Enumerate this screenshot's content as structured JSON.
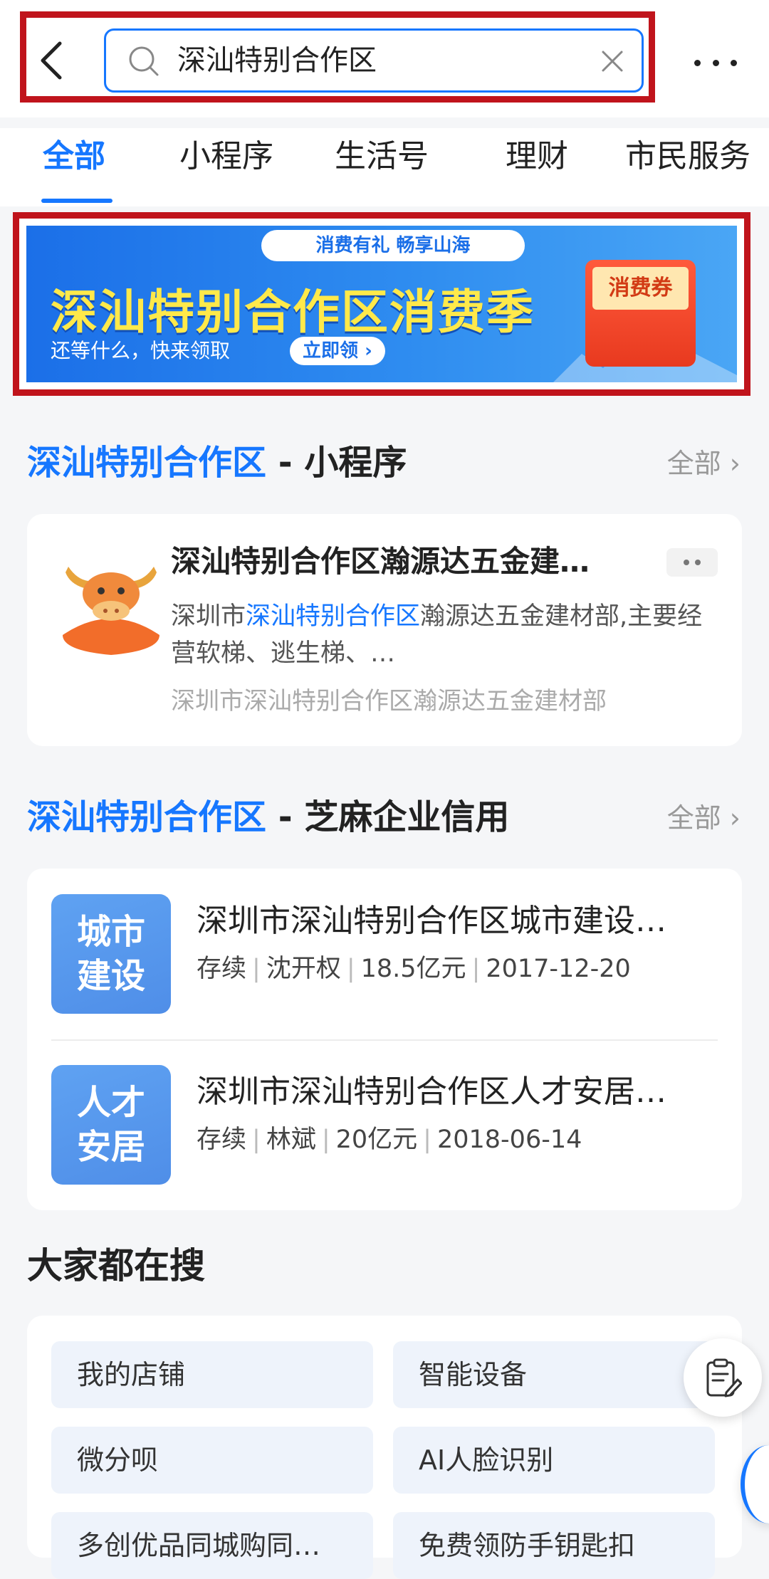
{
  "search": {
    "query": "深汕特别合作区"
  },
  "tabs": [
    {
      "label": "全部"
    },
    {
      "label": "小程序"
    },
    {
      "label": "生活号"
    },
    {
      "label": "理财"
    },
    {
      "label": "市民服务"
    }
  ],
  "banner": {
    "pill": "消费有礼 畅享山海",
    "title": "深汕特别合作区消费季",
    "subtitle": "还等什么，快来领取",
    "cta": "立即领",
    "coupon": "消费券"
  },
  "section_miniprogram": {
    "keyword": "深汕特别合作区",
    "suffix": " - 小程序",
    "more": "全部",
    "item": {
      "title": "深汕特别合作区瀚源达五金建…",
      "desc_prefix": "深圳市",
      "desc_keyword": "深汕特别合作区",
      "desc_rest": "瀚源达五金建材部,主要经营软梯、逃生梯、…",
      "footer": "深圳市深汕特别合作区瀚源达五金建材部"
    }
  },
  "section_credit": {
    "keyword": "深汕特别合作区",
    "suffix": " - 芝麻企业信用",
    "more": "全部",
    "companies": [
      {
        "icon_line1": "城市",
        "icon_line2": "建设",
        "name": "深圳市深汕特别合作区城市建设…",
        "status": "存续",
        "person": "沈开权",
        "capital": "18.5亿元",
        "date": "2017-12-20"
      },
      {
        "icon_line1": "人才",
        "icon_line2": "安居",
        "name": "深圳市深汕特别合作区人才安居…",
        "status": "存续",
        "person": "林斌",
        "capital": "20亿元",
        "date": "2018-06-14"
      }
    ]
  },
  "hot_search": {
    "title": "大家都在搜",
    "items": [
      "我的店铺",
      "智能设备",
      "微分呗",
      "AI人脸识别",
      "多创优品同城购同…",
      "免费领防手钥匙扣"
    ]
  },
  "colors": {
    "accent": "#1677ff",
    "highlight_box": "#c0141c",
    "banner_title": "#ffe94a"
  }
}
